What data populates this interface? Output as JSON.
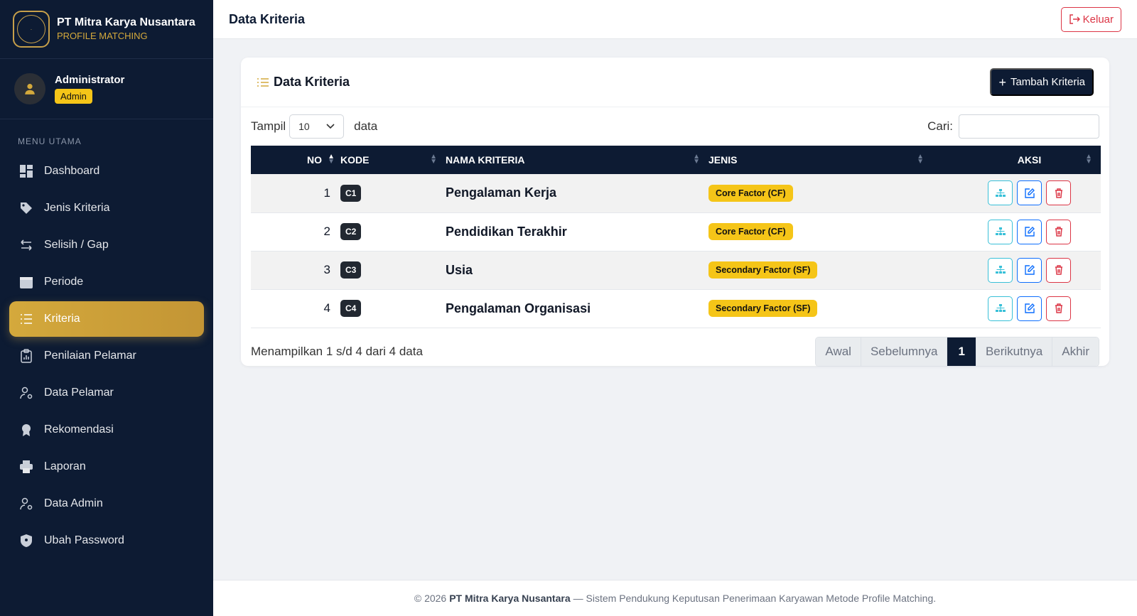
{
  "brand": {
    "name": "PT Mitra Karya Nusantara",
    "subtitle": "PROFILE MATCHING"
  },
  "user": {
    "name": "Administrator",
    "role": "Admin"
  },
  "menu": {
    "title": "MENU UTAMA",
    "items": [
      {
        "label": "Dashboard",
        "icon": "dashboard-icon"
      },
      {
        "label": "Jenis Kriteria",
        "icon": "tags-icon"
      },
      {
        "label": "Selisih / Gap",
        "icon": "arrows-icon"
      },
      {
        "label": "Periode",
        "icon": "calendar-icon"
      },
      {
        "label": "Kriteria",
        "icon": "list-icon",
        "active": true
      },
      {
        "label": "Penilaian Pelamar",
        "icon": "clipboard-chart-icon"
      },
      {
        "label": "Data Pelamar",
        "icon": "user-gear-icon"
      },
      {
        "label": "Rekomendasi",
        "icon": "award-icon"
      },
      {
        "label": "Laporan",
        "icon": "printer-icon"
      },
      {
        "label": "Data Admin",
        "icon": "user-gear-icon"
      },
      {
        "label": "Ubah Password",
        "icon": "shield-icon"
      }
    ]
  },
  "topbar": {
    "title": "Data Kriteria",
    "logout": "Keluar"
  },
  "card": {
    "title": "Data Kriteria",
    "add_button": "Tambah Kriteria"
  },
  "controls": {
    "show_prefix": "Tampil",
    "page_size": "10",
    "show_suffix": "data",
    "search_label": "Cari:",
    "search_value": ""
  },
  "table": {
    "headers": {
      "no": "NO",
      "kode": "KODE",
      "nama": "NAMA KRITERIA",
      "jenis": "JENIS",
      "aksi": "AKSI"
    },
    "rows": [
      {
        "no": "1",
        "kode": "C1",
        "nama": "Pengalaman Kerja",
        "jenis": "Core Factor (CF)"
      },
      {
        "no": "2",
        "kode": "C2",
        "nama": "Pendidikan Terakhir",
        "jenis": "Core Factor (CF)"
      },
      {
        "no": "3",
        "kode": "C3",
        "nama": "Usia",
        "jenis": "Secondary Factor (SF)"
      },
      {
        "no": "4",
        "kode": "C4",
        "nama": "Pengalaman Organisasi",
        "jenis": "Secondary Factor (SF)"
      }
    ]
  },
  "info": "Menampilkan 1 s/d 4 dari 4 data",
  "pagination": {
    "first": "Awal",
    "prev": "Sebelumnya",
    "current": "1",
    "next": "Berikutnya",
    "last": "Akhir"
  },
  "footer": {
    "prefix": "© 2026",
    "company": "PT Mitra Karya Nusantara",
    "suffix": "— Sistem Pendukung Keputusan Penerimaan Karyawan Metode Profile Matching."
  },
  "colors": {
    "navy": "#0d1b33",
    "gold": "#d4a93c",
    "yellow_badge": "#f5c518",
    "danger": "#dc3545",
    "primary": "#0d6efd",
    "info": "#39c0d8"
  }
}
